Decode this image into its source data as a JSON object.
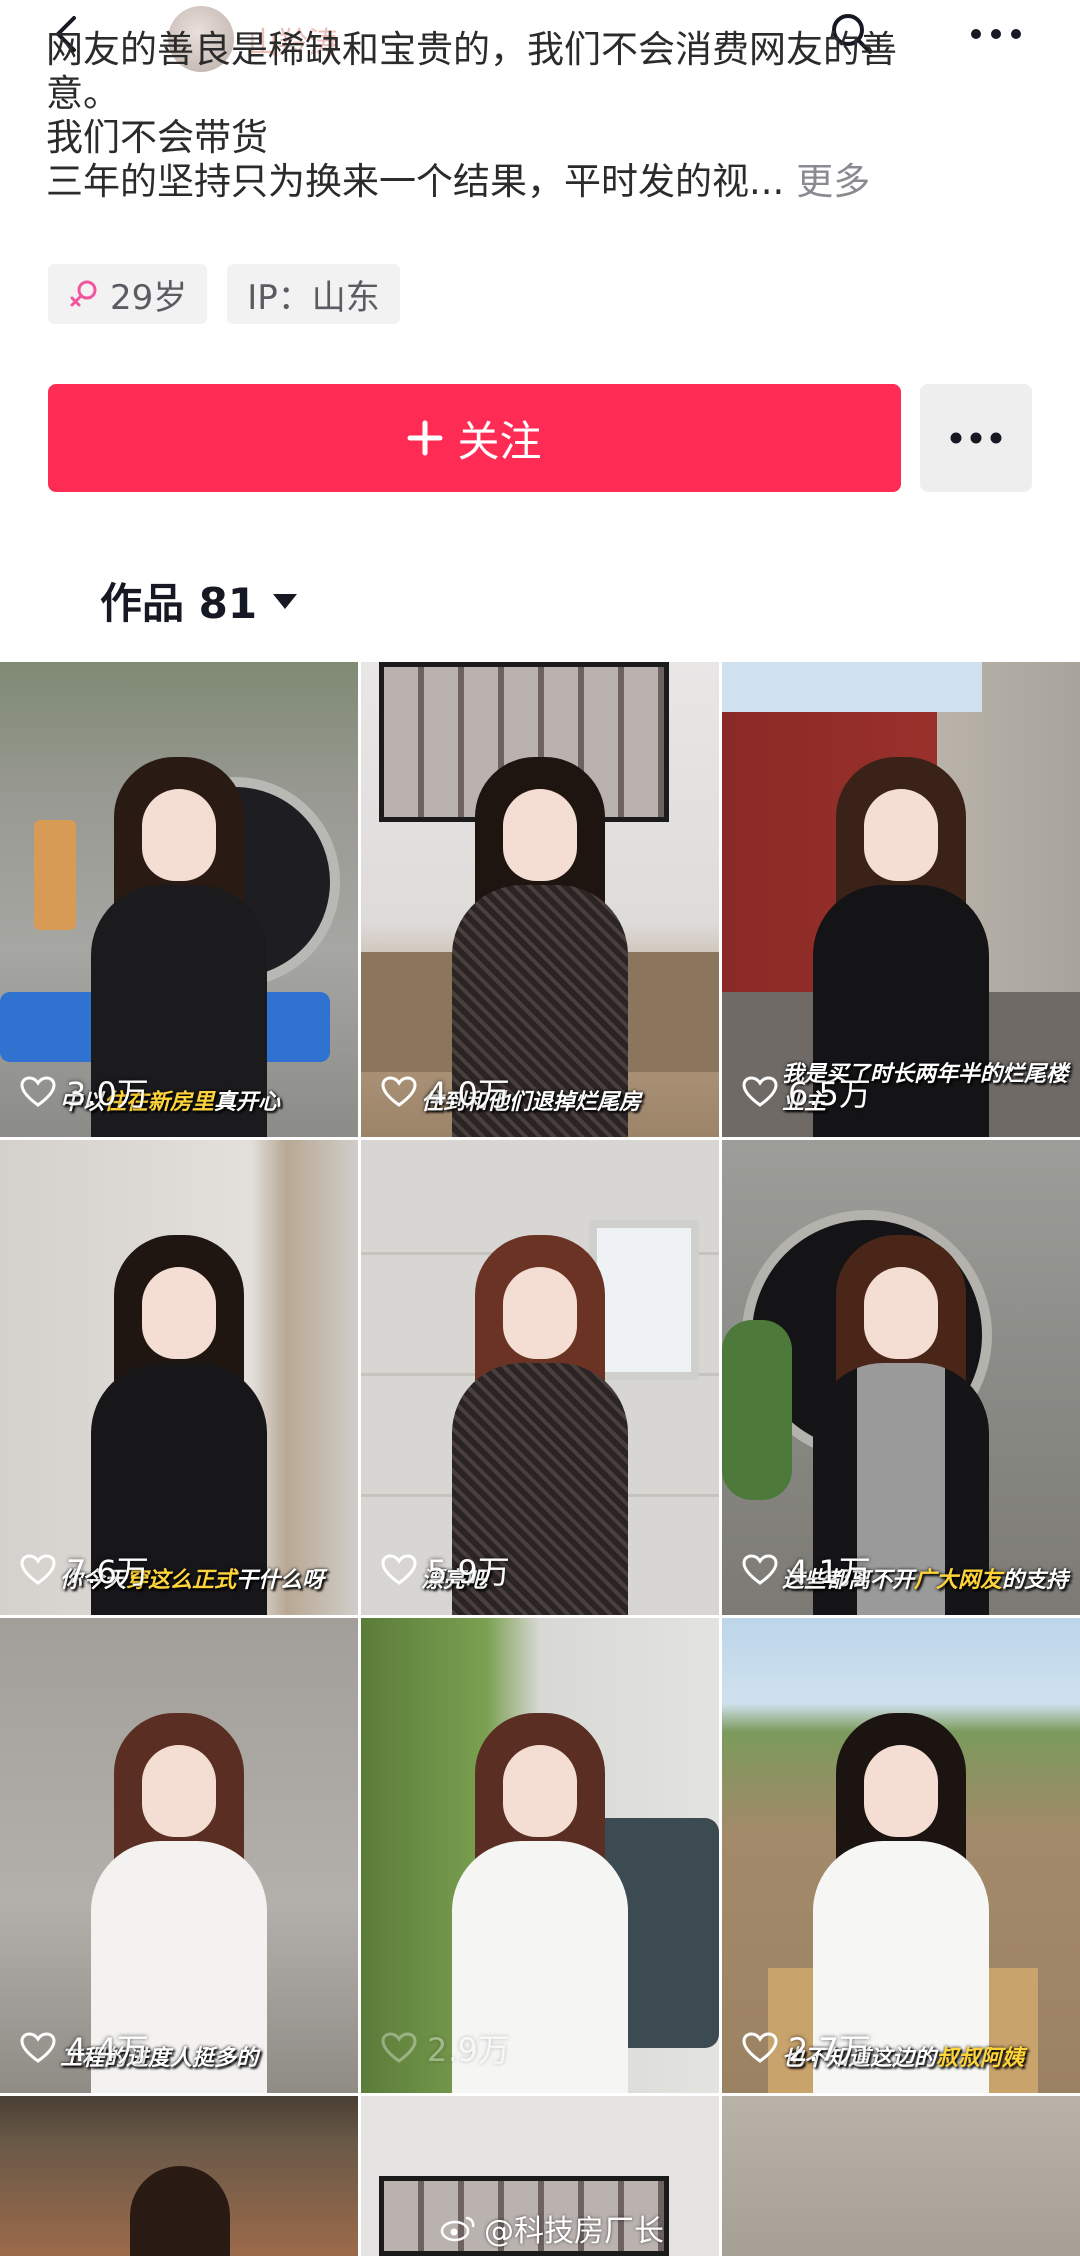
{
  "topbar": {
    "name_partial": "山羚涛"
  },
  "bio": {
    "line1": "网友的善良是稀缺和宝贵的，我们不会消费网友的善",
    "line2": "意。",
    "line3": "我们不会带货",
    "line4": "三年的坚持只为换来一个结果，平时发的视...",
    "more": "更多"
  },
  "tags": {
    "age": "29岁",
    "ip": "IP：山东"
  },
  "actions": {
    "follow_label": "关注"
  },
  "works": {
    "label": "作品 81"
  },
  "videos": [
    {
      "likes": "3.0万",
      "caption_a": "中以",
      "caption_hl": "住在新房里",
      "caption_b": "真开心"
    },
    {
      "likes": "4.0万",
      "caption_a": "住到",
      "caption_hl": "",
      "caption_b": "和他们退掉烂尾房"
    },
    {
      "likes": "6.5万",
      "caption_a": "我是买了时长两年半的烂",
      "caption_hl": "",
      "caption_b": "尾楼业主"
    },
    {
      "likes": "7.6万",
      "caption_a": "你今天",
      "caption_hl": "穿这么正式",
      "caption_b": "干什么呀"
    },
    {
      "likes": "5.9万",
      "caption_a": "漂亮吧",
      "caption_hl": "",
      "caption_b": ""
    },
    {
      "likes": "4.1万",
      "caption_a": "这些都离不开",
      "caption_hl": "广大网友",
      "caption_b": "的支持"
    },
    {
      "likes": "4.4万",
      "caption_a": "工程的进度人挺多的",
      "caption_hl": "",
      "caption_b": ""
    },
    {
      "likes": "2.9万",
      "caption_a": "",
      "caption_hl": "",
      "caption_b": ""
    },
    {
      "likes": "2.7万",
      "caption_a": "也不知道这边的",
      "caption_hl": "叔叔阿姨",
      "caption_b": ""
    }
  ],
  "watermark": {
    "text": "@科技房厂长"
  },
  "colors": {
    "accent": "#fe2c55",
    "tag_bg": "#f2f2f3",
    "female": "#f2559e"
  }
}
